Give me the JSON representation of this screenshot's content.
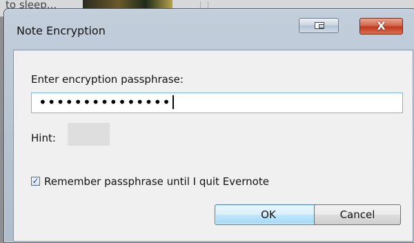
{
  "background": {
    "text": "to sleep..."
  },
  "window": {
    "title": "Note Encryption",
    "close_label": "X"
  },
  "form": {
    "prompt_label": "Enter encryption passphrase:",
    "passphrase_masked": "•••••••••••••••",
    "hint_label": "Hint:",
    "remember_label": "Remember passphrase until I quit Evernote",
    "remember_checked": true,
    "check_glyph": "✓"
  },
  "buttons": {
    "ok": "OK",
    "cancel": "Cancel"
  }
}
